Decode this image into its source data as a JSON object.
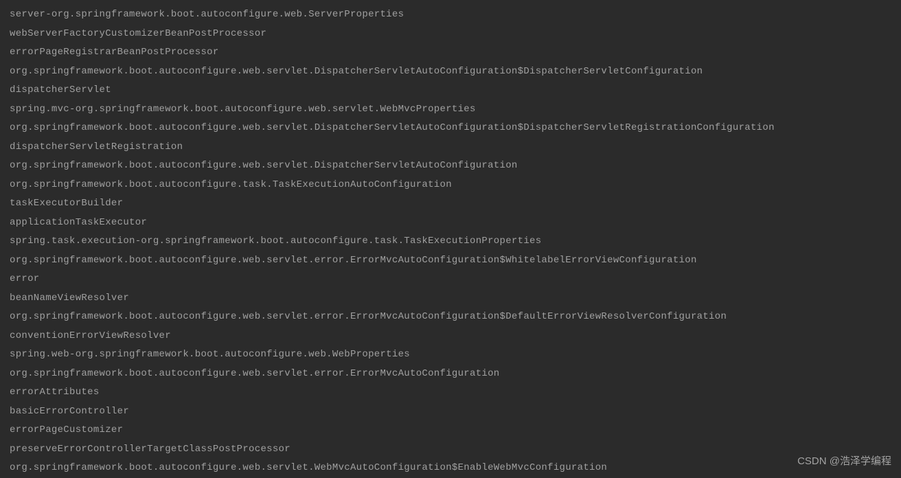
{
  "console": {
    "lines": [
      "server-org.springframework.boot.autoconfigure.web.ServerProperties",
      "webServerFactoryCustomizerBeanPostProcessor",
      "errorPageRegistrarBeanPostProcessor",
      "org.springframework.boot.autoconfigure.web.servlet.DispatcherServletAutoConfiguration$DispatcherServletConfiguration",
      "dispatcherServlet",
      "spring.mvc-org.springframework.boot.autoconfigure.web.servlet.WebMvcProperties",
      "org.springframework.boot.autoconfigure.web.servlet.DispatcherServletAutoConfiguration$DispatcherServletRegistrationConfiguration",
      "dispatcherServletRegistration",
      "org.springframework.boot.autoconfigure.web.servlet.DispatcherServletAutoConfiguration",
      "org.springframework.boot.autoconfigure.task.TaskExecutionAutoConfiguration",
      "taskExecutorBuilder",
      "applicationTaskExecutor",
      "spring.task.execution-org.springframework.boot.autoconfigure.task.TaskExecutionProperties",
      "org.springframework.boot.autoconfigure.web.servlet.error.ErrorMvcAutoConfiguration$WhitelabelErrorViewConfiguration",
      "error",
      "beanNameViewResolver",
      "org.springframework.boot.autoconfigure.web.servlet.error.ErrorMvcAutoConfiguration$DefaultErrorViewResolverConfiguration",
      "conventionErrorViewResolver",
      "spring.web-org.springframework.boot.autoconfigure.web.WebProperties",
      "org.springframework.boot.autoconfigure.web.servlet.error.ErrorMvcAutoConfiguration",
      "errorAttributes",
      "basicErrorController",
      "errorPageCustomizer",
      "preserveErrorControllerTargetClassPostProcessor",
      "org.springframework.boot.autoconfigure.web.servlet.WebMvcAutoConfiguration$EnableWebMvcConfiguration"
    ]
  },
  "watermark": "CSDN @浩泽学编程"
}
